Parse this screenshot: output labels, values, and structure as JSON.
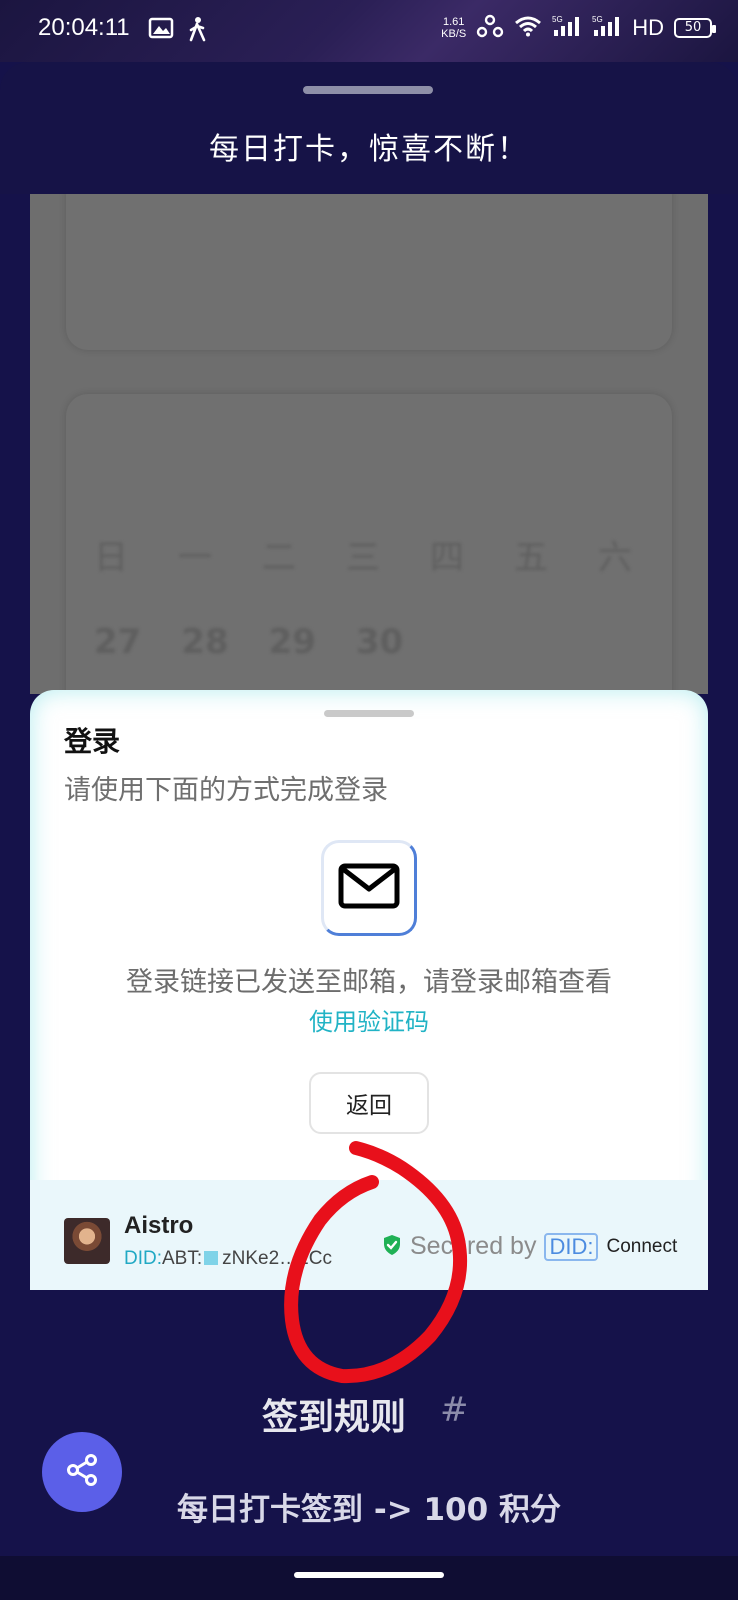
{
  "status_bar": {
    "time": "20:04:11",
    "speed_value": "1.61",
    "speed_unit": "KB/S",
    "network_label": "HD",
    "battery": "50",
    "icons": [
      "image-icon",
      "walking-icon",
      "hotspot-icon",
      "wifi-icon",
      "signal-5g-icon",
      "signal-5g-icon"
    ]
  },
  "header": {
    "title": "每日打卡，惊喜不断！"
  },
  "calendar": {
    "weekdays": [
      "日",
      "一",
      "二",
      "三",
      "四",
      "五",
      "六"
    ],
    "dates": [
      "27",
      "28",
      "29",
      "30"
    ]
  },
  "login_modal": {
    "title": "登录",
    "subtitle": "请使用下面的方式完成登录",
    "sent_message": "登录链接已发送至邮箱，请登录邮箱查看",
    "use_code_link": "使用验证码",
    "back_button": "返回",
    "footer": {
      "app_name": "Aistro",
      "did_prefix": "DID:",
      "did_value": "ABT:",
      "did_address": "zNKe2…1Cc",
      "secured_by": "Secured by",
      "did_logo": "DID:",
      "connect": "Connect"
    }
  },
  "rules": {
    "title": "签到规则",
    "hash": "#",
    "line1": "每日打卡签到 -> 100 积分"
  },
  "colors": {
    "background": "#15124a",
    "accent_link": "#21b3c5",
    "fab": "#5b5fe8",
    "annotation": "#e8101b"
  }
}
